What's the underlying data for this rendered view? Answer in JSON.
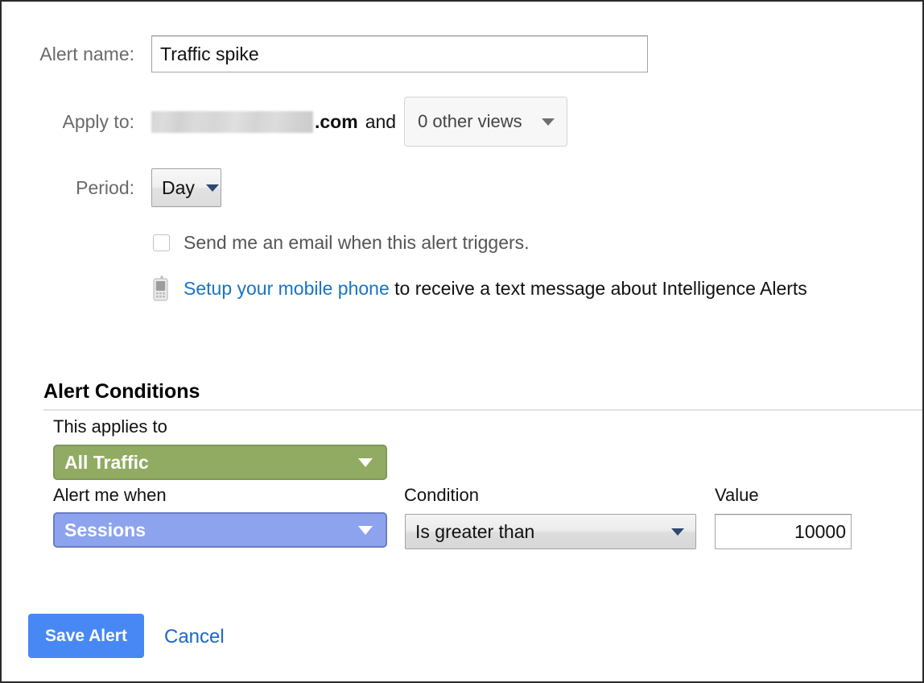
{
  "form": {
    "alert_name": {
      "label": "Alert name:",
      "value": "Traffic spike",
      "placeholder": ""
    },
    "apply_to": {
      "label": "Apply to:",
      "domain_suffix": ".com",
      "conjunction": "and",
      "views_select": "0 other views",
      "views_icon": "chevron-down-icon"
    },
    "period": {
      "label": "Period:",
      "value": "Day",
      "icon": "chevron-down-icon"
    },
    "email_checkbox": {
      "label": "Send me an email when this alert triggers.",
      "checked": false
    },
    "mobile": {
      "icon": "mobile-phone-icon",
      "link_text": "Setup your mobile phone",
      "rest_text": " to receive a text message about Intelligence Alerts"
    }
  },
  "alert_conditions": {
    "heading": "Alert Conditions",
    "this_applies_to": {
      "label": "This applies to",
      "value": "All Traffic",
      "icon": "chevron-down-icon",
      "color": "#91ab63",
      "border_color": "#7e985a"
    },
    "alert_me_when": {
      "label": "Alert me when",
      "value": "Sessions",
      "icon": "chevron-down-icon",
      "color": "#8da3ee",
      "border_color": "#6b7dc4"
    },
    "condition": {
      "label": "Condition",
      "value": "Is greater than",
      "icon": "chevron-down-icon"
    },
    "value_field": {
      "label": "Value",
      "value": "10000",
      "placeholder": ""
    }
  },
  "footer": {
    "save_label": "Save Alert",
    "cancel_label": "Cancel",
    "save_color": "#4788f4",
    "link_color": "#1c68c4"
  }
}
